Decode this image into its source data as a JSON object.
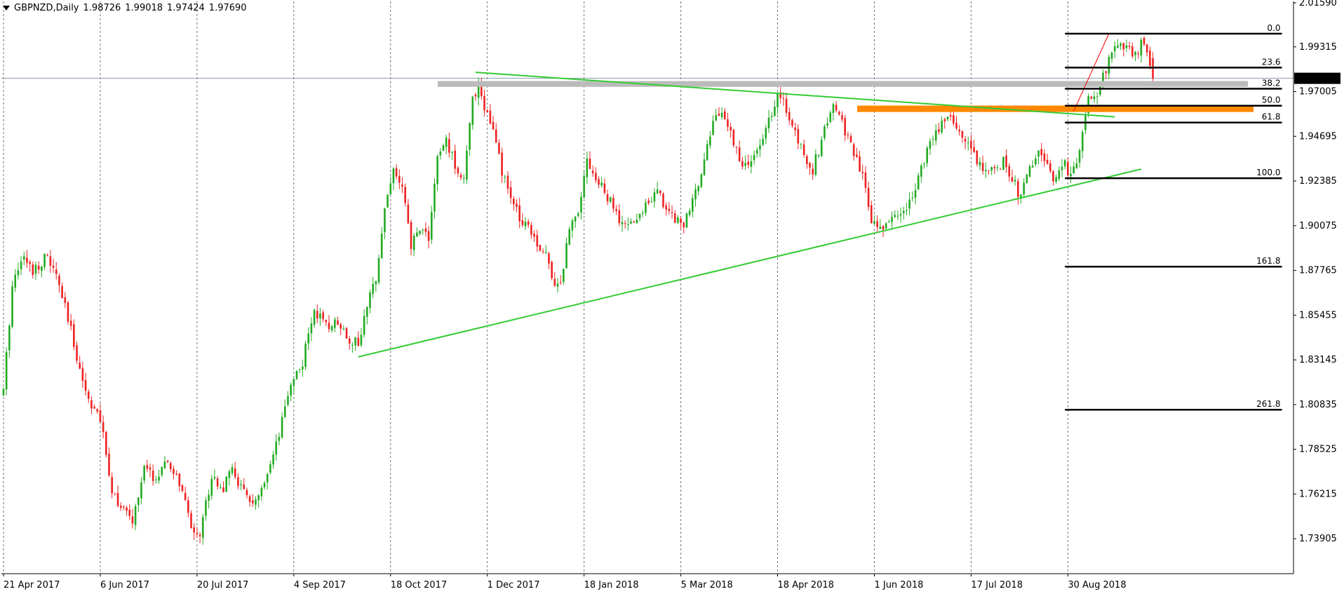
{
  "header": {
    "symbol": "GBPNZD,Daily",
    "open": "1.98726",
    "high": "1.99018",
    "low": "1.97424",
    "close": "1.97690"
  },
  "current_price_label": "1.97690",
  "colors": {
    "up_candle": "#22aa22",
    "down_candle": "#ee2222",
    "grid": "#000000",
    "trendline": "#33cc33",
    "fib_level": "#000000",
    "resistance_zone": "#bbbbbb",
    "support_zone": "#ff8800",
    "fib_impulse": "#ff0000",
    "price_tag_bg": "#000000",
    "price_tag_text": "#ffffff"
  },
  "chart_data": {
    "type": "candlestick",
    "title": "GBPNZD,Daily",
    "grid": true,
    "y_axis_side": "right",
    "ylim": [
      1.725,
      2.0159
    ],
    "yticks": [
      "2.01590",
      "1.99315",
      "1.97005",
      "1.94695",
      "1.92385",
      "1.90075",
      "1.87765",
      "1.85455",
      "1.83145",
      "1.80835",
      "1.78525",
      "1.76215",
      "1.73905"
    ],
    "xticks": [
      {
        "i": 0,
        "label": "21 Apr 2017"
      },
      {
        "i": 33,
        "label": "6 Jun 2017"
      },
      {
        "i": 66,
        "label": "20 Jul 2017"
      },
      {
        "i": 99,
        "label": "4 Sep 2017"
      },
      {
        "i": 132,
        "label": "18 Oct 2017"
      },
      {
        "i": 165,
        "label": "1 Dec 2017"
      },
      {
        "i": 198,
        "label": "18 Jan 2018"
      },
      {
        "i": 231,
        "label": "5 Mar 2018"
      },
      {
        "i": 264,
        "label": "18 Apr 2018"
      },
      {
        "i": 297,
        "label": "1 Jun 2018"
      },
      {
        "i": 330,
        "label": "17 Jul 2018"
      },
      {
        "i": 363,
        "label": "30 Aug 2018"
      }
    ],
    "close_path": [
      [
        0,
        1.815
      ],
      [
        3,
        1.87
      ],
      [
        6,
        1.885
      ],
      [
        10,
        1.878
      ],
      [
        15,
        1.885
      ],
      [
        19,
        1.87
      ],
      [
        24,
        1.84
      ],
      [
        28,
        1.815
      ],
      [
        33,
        1.8
      ],
      [
        37,
        1.765
      ],
      [
        40,
        1.755
      ],
      [
        44,
        1.748
      ],
      [
        48,
        1.775
      ],
      [
        52,
        1.77
      ],
      [
        56,
        1.778
      ],
      [
        60,
        1.768
      ],
      [
        64,
        1.745
      ],
      [
        67,
        1.742
      ],
      [
        71,
        1.772
      ],
      [
        75,
        1.765
      ],
      [
        78,
        1.775
      ],
      [
        82,
        1.762
      ],
      [
        86,
        1.757
      ],
      [
        90,
        1.77
      ],
      [
        94,
        1.792
      ],
      [
        98,
        1.82
      ],
      [
        102,
        1.83
      ],
      [
        106,
        1.858
      ],
      [
        110,
        1.848
      ],
      [
        114,
        1.852
      ],
      [
        118,
        1.842
      ],
      [
        121,
        1.84
      ],
      [
        124,
        1.858
      ],
      [
        127,
        1.875
      ],
      [
        130,
        1.91
      ],
      [
        133,
        1.93
      ],
      [
        136,
        1.92
      ],
      [
        139,
        1.89
      ],
      [
        142,
        1.9
      ],
      [
        145,
        1.895
      ],
      [
        148,
        1.935
      ],
      [
        151,
        1.945
      ],
      [
        154,
        1.932
      ],
      [
        157,
        1.925
      ],
      [
        160,
        1.965
      ],
      [
        162,
        1.975
      ],
      [
        164,
        1.962
      ],
      [
        167,
        1.95
      ],
      [
        170,
        1.928
      ],
      [
        173,
        1.915
      ],
      [
        176,
        1.905
      ],
      [
        179,
        1.902
      ],
      [
        182,
        1.892
      ],
      [
        185,
        1.885
      ],
      [
        188,
        1.872
      ],
      [
        190,
        1.87
      ],
      [
        193,
        1.9
      ],
      [
        196,
        1.91
      ],
      [
        199,
        1.935
      ],
      [
        202,
        1.925
      ],
      [
        205,
        1.918
      ],
      [
        208,
        1.91
      ],
      [
        211,
        1.9
      ],
      [
        214,
        1.902
      ],
      [
        217,
        1.905
      ],
      [
        220,
        1.915
      ],
      [
        223,
        1.918
      ],
      [
        226,
        1.91
      ],
      [
        229,
        1.905
      ],
      [
        232,
        1.902
      ],
      [
        235,
        1.912
      ],
      [
        238,
        1.93
      ],
      [
        241,
        1.948
      ],
      [
        243,
        1.96
      ],
      [
        246,
        1.955
      ],
      [
        249,
        1.945
      ],
      [
        252,
        1.93
      ],
      [
        255,
        1.935
      ],
      [
        258,
        1.94
      ],
      [
        261,
        1.955
      ],
      [
        263,
        1.965
      ],
      [
        265,
        1.968
      ],
      [
        267,
        1.96
      ],
      [
        270,
        1.948
      ],
      [
        273,
        1.938
      ],
      [
        276,
        1.93
      ],
      [
        279,
        1.945
      ],
      [
        282,
        1.96
      ],
      [
        284,
        1.962
      ],
      [
        287,
        1.95
      ],
      [
        290,
        1.938
      ],
      [
        293,
        1.925
      ],
      [
        296,
        1.905
      ],
      [
        299,
        1.898
      ],
      [
        302,
        1.905
      ],
      [
        305,
        1.905
      ],
      [
        308,
        1.91
      ],
      [
        311,
        1.922
      ],
      [
        314,
        1.935
      ],
      [
        317,
        1.945
      ],
      [
        320,
        1.955
      ],
      [
        323,
        1.958
      ],
      [
        326,
        1.948
      ],
      [
        329,
        1.945
      ],
      [
        332,
        1.935
      ],
      [
        335,
        1.93
      ],
      [
        338,
        1.928
      ],
      [
        341,
        1.935
      ],
      [
        344,
        1.925
      ],
      [
        347,
        1.915
      ],
      [
        350,
        1.93
      ],
      [
        353,
        1.94
      ],
      [
        356,
        1.93
      ],
      [
        359,
        1.925
      ],
      [
        362,
        1.932
      ],
      [
        364,
        1.925
      ],
      [
        366,
        1.935
      ],
      [
        368,
        1.95
      ],
      [
        370,
        1.965
      ],
      [
        372,
        1.965
      ],
      [
        374,
        1.975
      ],
      [
        376,
        1.98
      ],
      [
        378,
        1.993
      ],
      [
        380,
        1.995
      ],
      [
        382,
        1.99
      ],
      [
        384,
        1.992
      ],
      [
        386,
        1.988
      ],
      [
        388,
        1.995
      ],
      [
        390,
        1.99
      ],
      [
        392,
        1.9769
      ]
    ],
    "annotations": {
      "current_price": 1.9769,
      "resistance_zone": [
        1.9725,
        1.9755
      ],
      "support_zone": [
        1.9595,
        1.9628
      ],
      "upper_trendline": {
        "from": [
          161,
          1.98
        ],
        "to": [
          379,
          1.957
        ]
      },
      "lower_trendline": {
        "from": [
          121,
          1.833
        ],
        "to": [
          388,
          1.93
        ]
      },
      "fib_impulse_line": {
        "from": [
          365,
          1.96
        ],
        "to": [
          377,
          2.0
        ]
      },
      "fibonacci": {
        "x_from": 362,
        "x_to": 436,
        "levels": [
          {
            "label": "0.0",
            "price": 1.99995
          },
          {
            "label": "23.6",
            "price": 1.98245
          },
          {
            "label": "38.2",
            "price": 1.9715
          },
          {
            "label": "50.0",
            "price": 1.96275
          },
          {
            "label": "61.8",
            "price": 1.95405
          },
          {
            "label": "100.0",
            "price": 1.9253
          },
          {
            "label": "161.8",
            "price": 1.8796
          },
          {
            "label": "261.8",
            "price": 1.8057
          }
        ]
      }
    }
  }
}
